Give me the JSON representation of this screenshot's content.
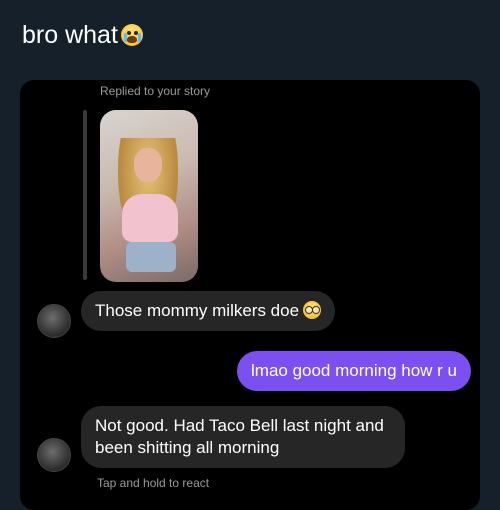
{
  "post": {
    "title": "bro what",
    "emoji": "loudly-crying-face-emoji"
  },
  "conversation": {
    "story_reply_label": "Replied to your story",
    "messages": [
      {
        "direction": "incoming",
        "text": "Those mommy milkers doe",
        "emoji": "nerd-face-emoji"
      },
      {
        "direction": "outgoing",
        "text": "lmao good morning how r u"
      },
      {
        "direction": "incoming",
        "text": "Not good. Had Taco Bell last night and been shitting all morning"
      }
    ],
    "react_hint": "Tap and hold to react"
  }
}
